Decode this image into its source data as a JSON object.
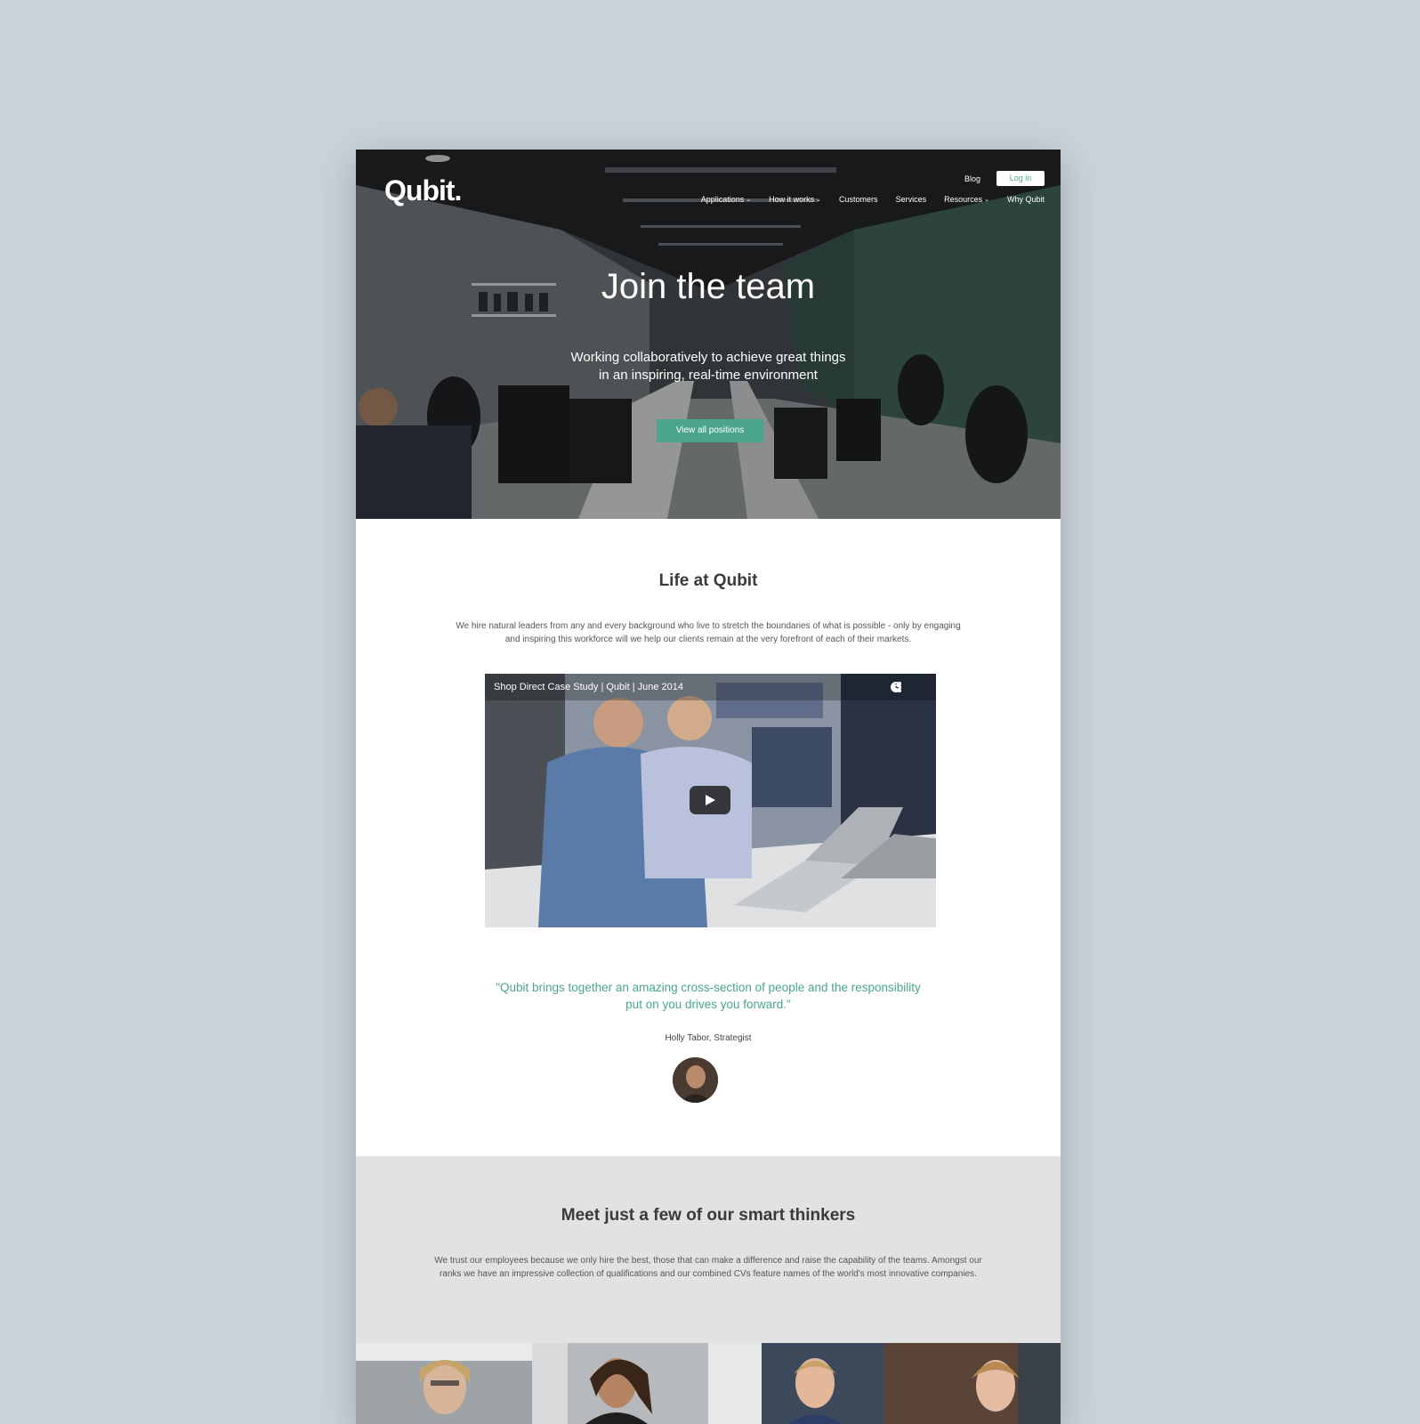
{
  "brand": {
    "logo": "Qubit.",
    "accent": "#4aa58a"
  },
  "nav": {
    "blog": "Blog",
    "login": "Log in",
    "items": [
      {
        "label": "Applications",
        "dropdown": true
      },
      {
        "label": "How it works",
        "dropdown": true
      },
      {
        "label": "Customers",
        "dropdown": false
      },
      {
        "label": "Services",
        "dropdown": false
      },
      {
        "label": "Resources",
        "dropdown": true
      },
      {
        "label": "Why Qubit",
        "dropdown": false
      }
    ]
  },
  "hero": {
    "title": "Join the team",
    "subtitle_line1": "Working collaboratively to achieve great things",
    "subtitle_line2": "in an inspiring, real-time environment",
    "cta": "View all positions"
  },
  "life": {
    "title": "Life at Qubit",
    "text": "We hire natural leaders from any and every background who live to stretch the boundaries of what is possible - only by engaging and inspiring this workforce will we help our clients remain at the very forefront of each of their markets.",
    "video": {
      "title": "Shop Direct Case Study | Qubit | June 2014",
      "icons": [
        "clock-icon",
        "share-icon",
        "play-icon"
      ]
    }
  },
  "testimonial": {
    "quote": "\"Qubit brings together an amazing cross-section of people and the responsibility put on you drives you forward.\"",
    "author": "Holly Tabor, Strategist"
  },
  "thinkers": {
    "title": "Meet just a few of our smart thinkers",
    "text": "We trust our employees because we only hire the best, those that can make a difference and raise the capability of the teams. Amongst our ranks we have an impressive collection of qualifications and our combined CVs feature names of the world's most innovative companies."
  }
}
